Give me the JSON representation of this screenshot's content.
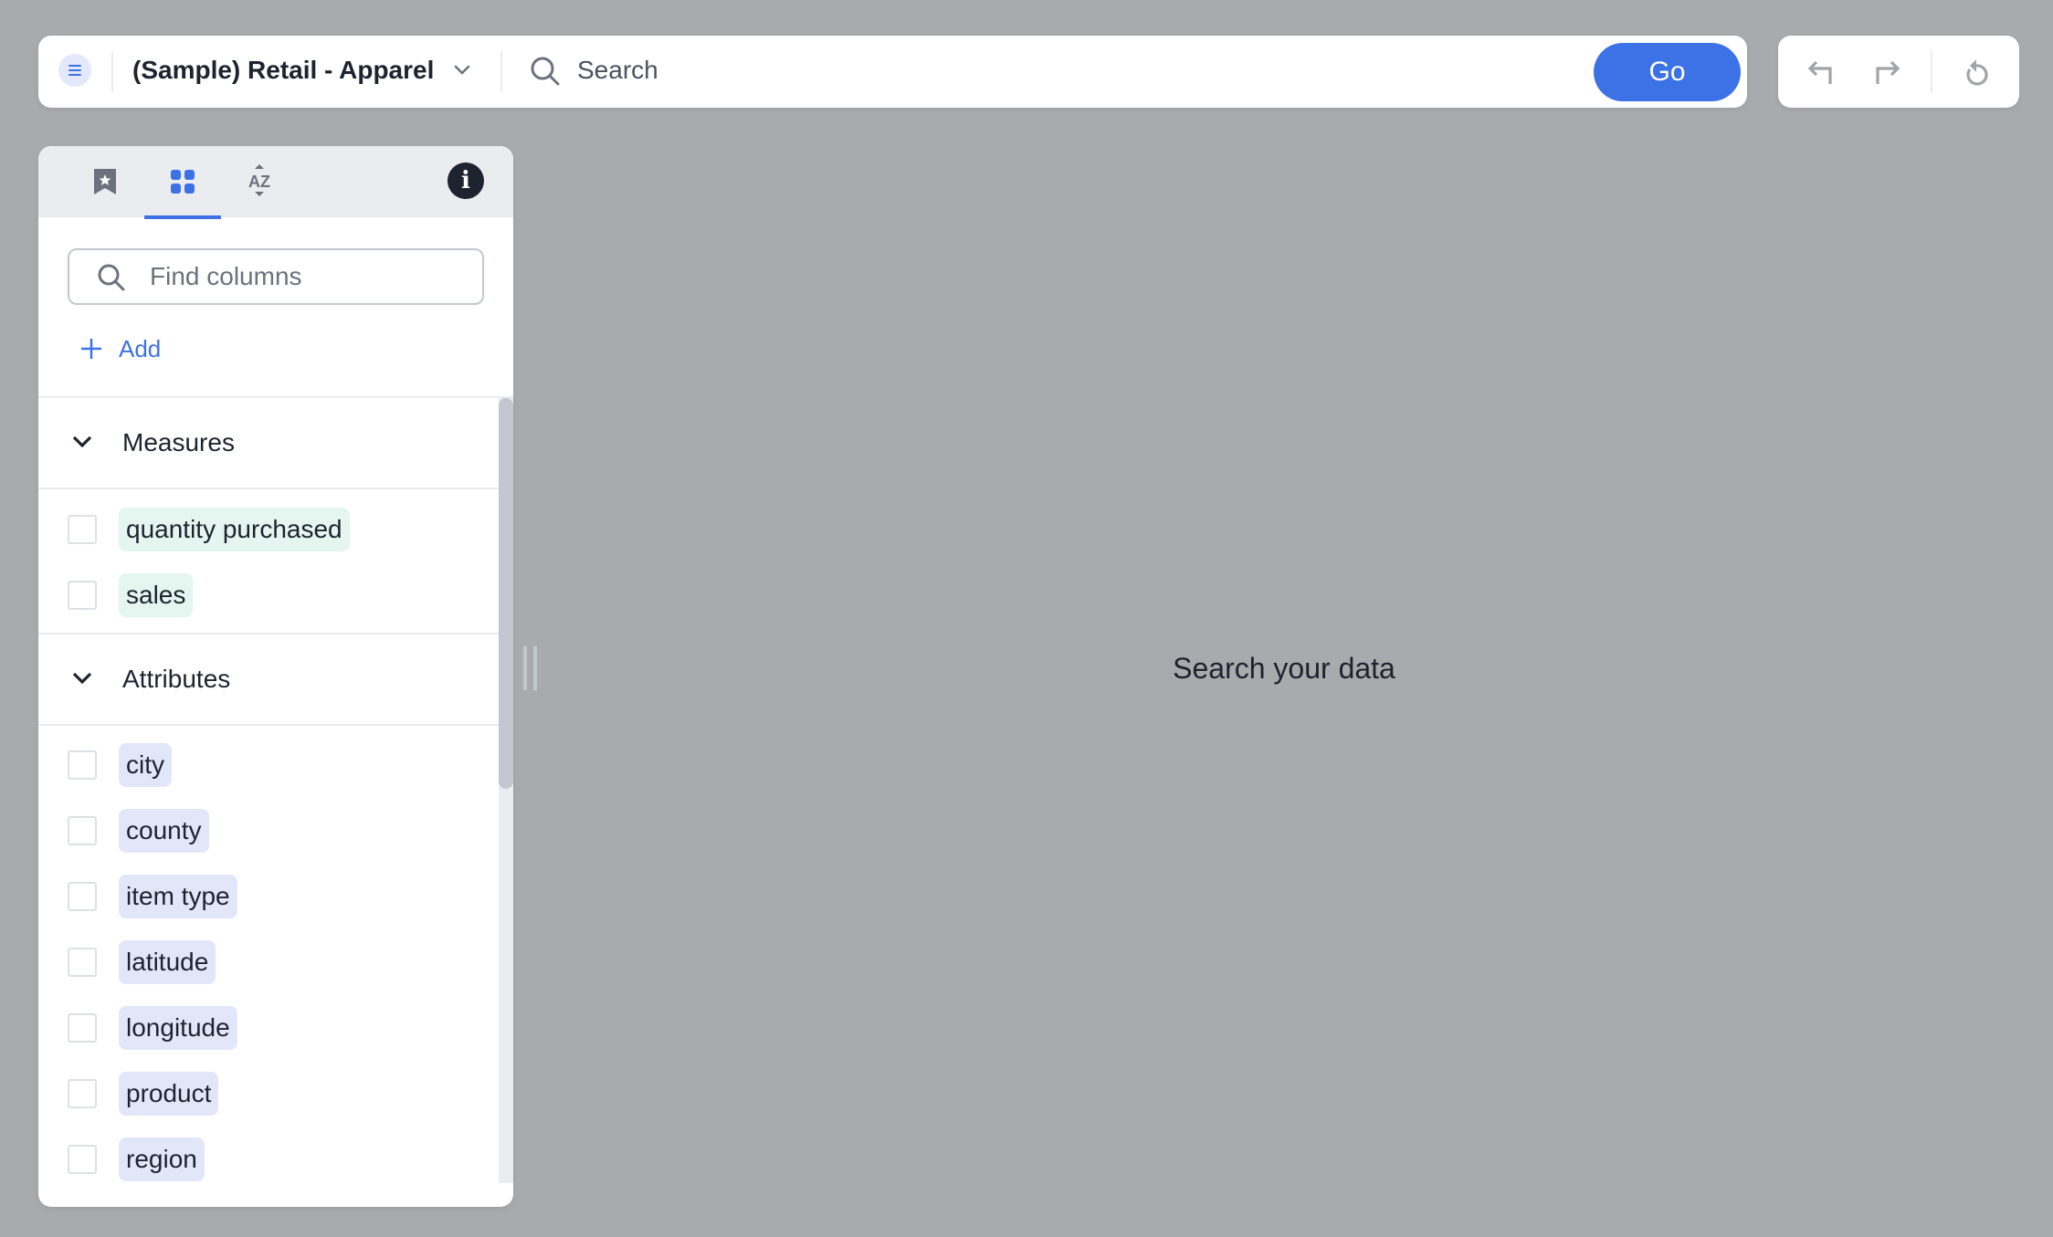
{
  "header": {
    "datasource_title": "(Sample) Retail - Apparel",
    "search_placeholder": "Search",
    "search_value": "",
    "go_label": "Go",
    "icons": {
      "menu": "menu-icon",
      "datasource_dropdown": "chevron-down-icon",
      "search": "search-icon"
    }
  },
  "history": {
    "undo": "undo-icon",
    "redo": "redo-icon",
    "reset": "reset-icon"
  },
  "data_panel": {
    "tabs": [
      {
        "id": "bookmarks",
        "icon": "bookmark-star-icon",
        "active": false
      },
      {
        "id": "columns",
        "icon": "grid-icon",
        "active": true
      },
      {
        "id": "sort",
        "icon": "sort-az-icon",
        "active": false
      }
    ],
    "info_icon": "i",
    "find_placeholder": "Find columns",
    "find_value": "",
    "add_label": "Add",
    "sections": [
      {
        "title": "Measures",
        "expanded": true,
        "type": "measure",
        "columns": [
          "quantity purchased",
          "sales"
        ]
      },
      {
        "title": "Attributes",
        "expanded": true,
        "type": "attribute",
        "columns": [
          "city",
          "county",
          "item type",
          "latitude",
          "longitude",
          "product",
          "region"
        ]
      }
    ]
  },
  "main": {
    "empty_message": "Search your data"
  },
  "colors": {
    "accent": "#3d72e6",
    "background": "#a9aaad",
    "measure_chip": "#e5f5f0",
    "attribute_chip": "#e1e7f8",
    "text": "#1d232f"
  }
}
